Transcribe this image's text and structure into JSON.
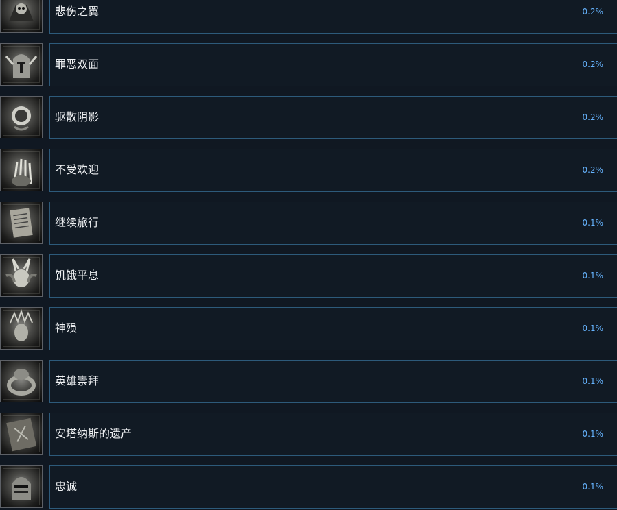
{
  "achievements": [
    {
      "name": "悲伤之翼",
      "percent": "0.2%",
      "icon": "winged-skull-icon"
    },
    {
      "name": "罪恶双面",
      "percent": "0.2%",
      "icon": "knight-helmet-icon"
    },
    {
      "name": "驱散阴影",
      "percent": "0.2%",
      "icon": "dark-orb-icon"
    },
    {
      "name": "不受欢迎",
      "percent": "0.2%",
      "icon": "clawed-hand-icon"
    },
    {
      "name": "继续旅行",
      "percent": "0.1%",
      "icon": "scroll-icon"
    },
    {
      "name": "饥饿平息",
      "percent": "0.1%",
      "icon": "horned-demon-icon"
    },
    {
      "name": "神殒",
      "percent": "0.1%",
      "icon": "crowned-head-icon"
    },
    {
      "name": "英雄崇拜",
      "percent": "0.1%",
      "icon": "ring-icon"
    },
    {
      "name": "安塔纳斯的遗产",
      "percent": "0.1%",
      "icon": "tome-icon"
    },
    {
      "name": "忠诚",
      "percent": "0.1%",
      "icon": "visored-helmet-icon"
    }
  ],
  "colors": {
    "background": "#101822",
    "panel_border": "#2d5a7a",
    "name_text": "#eef0f2",
    "percent_text": "#66b4ff"
  }
}
